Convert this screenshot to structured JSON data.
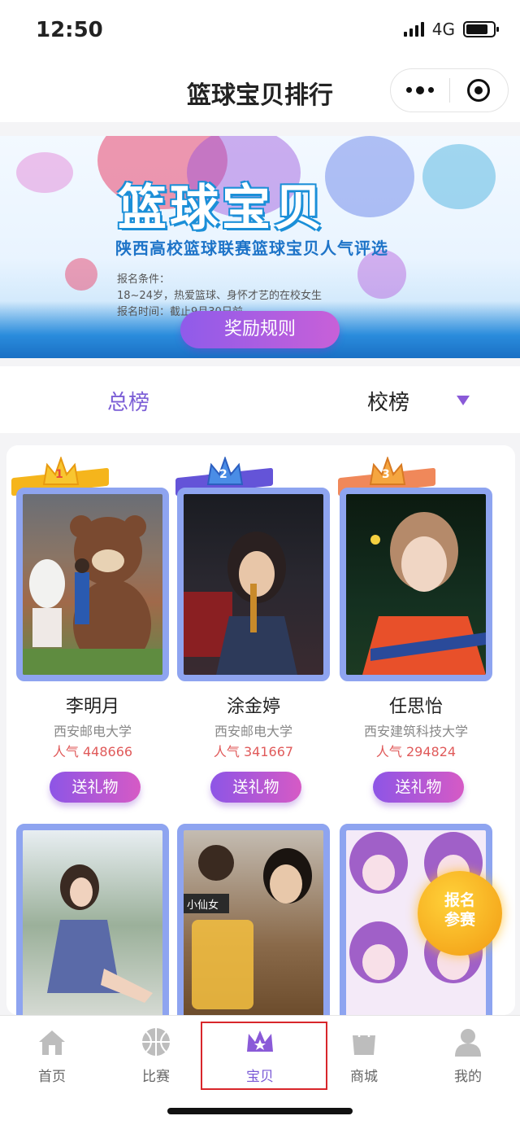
{
  "status": {
    "time": "12:50",
    "network": "4G"
  },
  "navbar": {
    "title": "篮球宝贝排行"
  },
  "banner": {
    "title": "篮球宝贝",
    "subtitle": "陕西高校篮球联赛篮球宝贝人气评选",
    "line1": "报名条件：",
    "line2": "18~24岁，热爱篮球、身怀才艺的在校女生",
    "line3": "报名时间：截止9月30日前",
    "rules_button": "奖励规则"
  },
  "tabs": {
    "total": "总榜",
    "school": "校榜"
  },
  "ranking": [
    {
      "rank": "1",
      "name": "李明月",
      "school": "西安邮电大学",
      "popularity": "人气 448666",
      "gift": "送礼物"
    },
    {
      "rank": "2",
      "name": "涂金婷",
      "school": "西安邮电大学",
      "popularity": "人气 341667",
      "gift": "送礼物"
    },
    {
      "rank": "3",
      "name": "任思怡",
      "school": "西安建筑科技大学",
      "popularity": "人气 294824",
      "gift": "送礼物"
    }
  ],
  "more": [
    {
      "caption": ""
    },
    {
      "caption": "小仙女"
    },
    {
      "caption": ""
    }
  ],
  "signup_button": {
    "line1": "报名",
    "line2": "参赛"
  },
  "tabbar": [
    {
      "label": "首页",
      "icon": "home-icon"
    },
    {
      "label": "比赛",
      "icon": "basketball-icon"
    },
    {
      "label": "宝贝",
      "icon": "crown-icon"
    },
    {
      "label": "商城",
      "icon": "shopping-bag-icon"
    },
    {
      "label": "我的",
      "icon": "user-icon"
    }
  ],
  "colors": {
    "accent": "#7b5ed6",
    "frame": "#8ea4f0",
    "popularity": "#e05a5a",
    "selected_border": "#d8262b"
  }
}
